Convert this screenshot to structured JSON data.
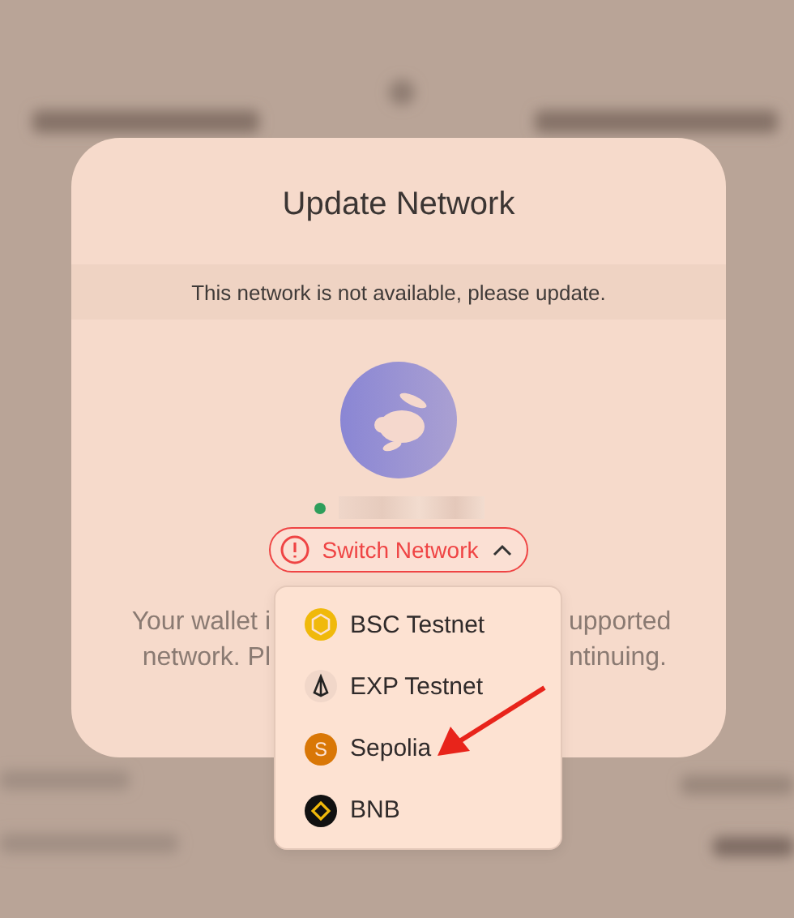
{
  "dialog": {
    "title": "Update Network",
    "notice": "This network is not available, please update.",
    "switch_button": {
      "label": "Switch Network",
      "expanded": true
    },
    "message_lines": [
      {
        "left": "Your wallet i",
        "right": "upported"
      },
      {
        "left": "network. Pl",
        "right": "ntinuing."
      }
    ],
    "menu": {
      "items": [
        {
          "label": "BSC Testnet",
          "kind": "bsc"
        },
        {
          "label": "EXP Testnet",
          "kind": "exp"
        },
        {
          "label": "Sepolia",
          "kind": "letter",
          "badge": "S"
        },
        {
          "label": "BNB",
          "kind": "bnb"
        }
      ]
    }
  }
}
